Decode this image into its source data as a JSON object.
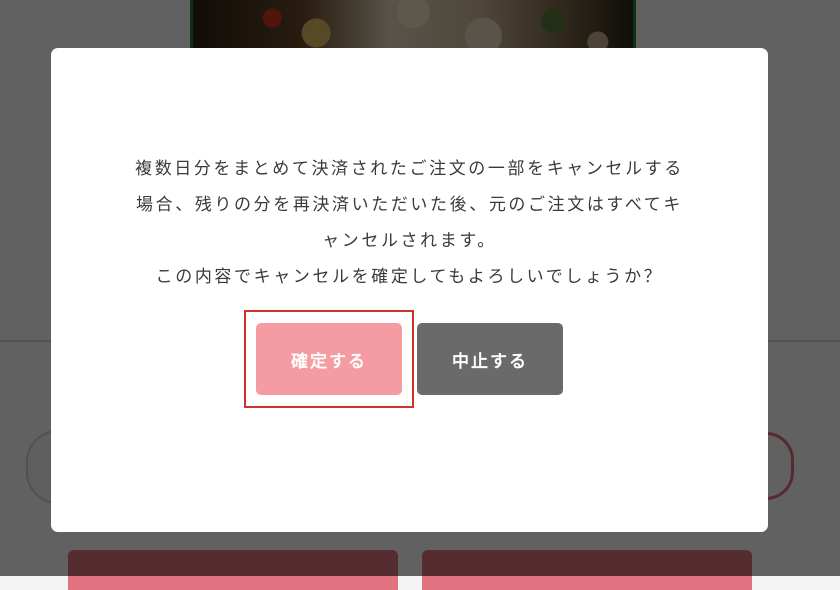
{
  "dialog": {
    "message_lines": [
      "複数日分をまとめて決済されたご注文の一部をキャンセルする",
      "場合、残りの分を再決済いただいた後、元のご注文はすべてキ",
      "ャンセルされます。",
      "この内容でキャンセルを確定してもよろしいでしょうか？"
    ],
    "confirm_label": "確定する",
    "cancel_label": "中止する"
  },
  "colors": {
    "confirm_button": "#f59ba2",
    "cancel_button": "#6a6a6a",
    "highlight_border": "#d0332a",
    "overlay": "rgba(0,0,0,0.62)"
  }
}
